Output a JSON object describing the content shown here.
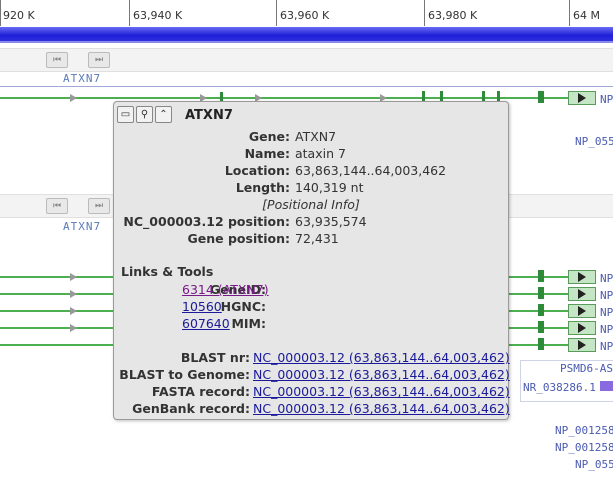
{
  "ruler": {
    "ticks": [
      "920 K",
      "63,940 K",
      "63,960 K",
      "63,980 K",
      "64 M"
    ]
  },
  "tracks": {
    "top_title": "ATXN7",
    "mid_title": "ATXN7",
    "nav_prev": "⏮",
    "nav_next": "⏭"
  },
  "right_labels": {
    "np_top": "NP",
    "np_055_1": "NP_055",
    "np_rows": [
      "NP",
      "NP",
      "NP",
      "NP",
      "NP"
    ],
    "psmd": "PSMD6-AS",
    "nr": "NR_038286.1",
    "np_0012_a": "NP_001258",
    "np_0012_b": "NP_001258",
    "np_055_2": "NP_055"
  },
  "popup": {
    "title": "ATXN7",
    "gene_label": "Gene:",
    "gene": "ATXN7",
    "name_label": "Name:",
    "name": "ataxin 7",
    "location_label": "Location:",
    "location": "63,863,144..64,003,462",
    "length_label": "Length:",
    "length": "140,319 nt",
    "positional_info": "Positional Info",
    "nc_pos_label": "NC_000003.12 position:",
    "nc_pos": "63,935,574",
    "gene_pos_label": "Gene position:",
    "gene_pos": "72,431",
    "links_heading": "Links & Tools",
    "geneid_label": "GeneID:",
    "geneid": "6314 (ATXN7)",
    "hgnc_label": "HGNC:",
    "hgnc": "10560",
    "mim_label": "MIM:",
    "mim": "607640",
    "blast_nr_label": "BLAST nr:",
    "blast_nr": "NC_000003.12 (63,863,144..64,003,462)",
    "blast_genome_label": "BLAST to Genome:",
    "blast_genome": "NC_000003.12 (63,863,144..64,003,462)",
    "fasta_label": "FASTA record:",
    "fasta": "NC_000003.12 (63,863,144..64,003,462)",
    "genbank_label": "GenBank record:",
    "genbank": "NC_000003.12 (63,863,144..64,003,462)"
  }
}
